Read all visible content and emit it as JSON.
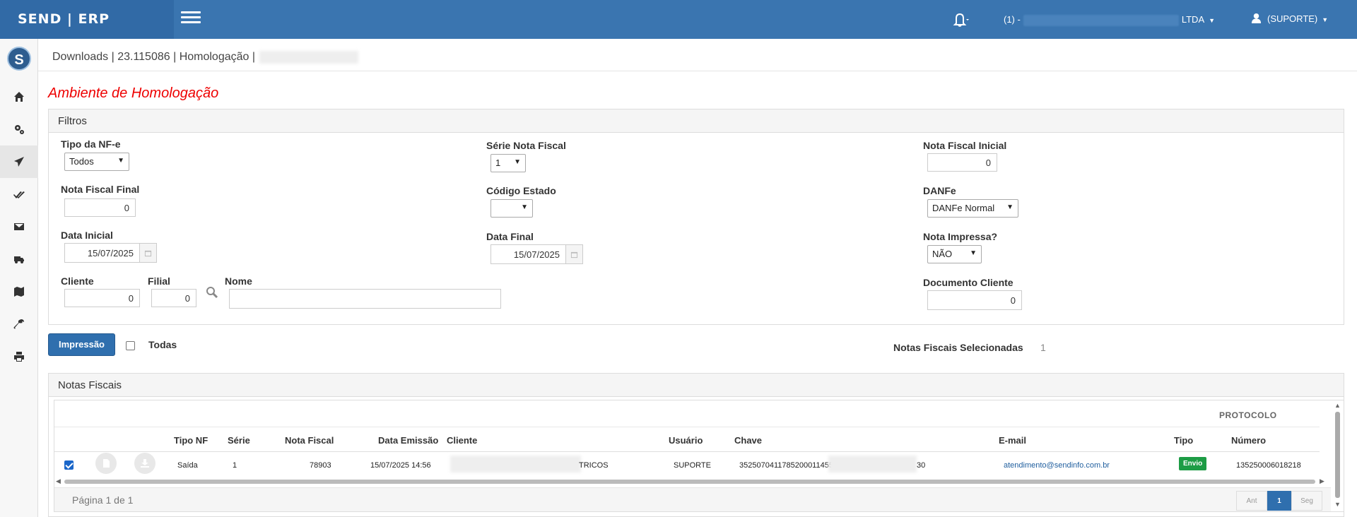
{
  "app": {
    "brand": "SEND | ERP"
  },
  "topbar": {
    "company_prefix": "(1) -",
    "company_suffix": "LTDA",
    "user_label": "(SUPORTE)"
  },
  "breadcrumb": "Downloads | 23.115086 | Homologação |",
  "env_title": "Ambiente de Homologação",
  "filters": {
    "panel_title": "Filtros",
    "tipo_nfe": {
      "label": "Tipo da NF-e",
      "value": "Todos"
    },
    "serie": {
      "label": "Série Nota Fiscal",
      "value": "1"
    },
    "nf_inicial": {
      "label": "Nota Fiscal Inicial",
      "value": "0"
    },
    "nf_final": {
      "label": "Nota Fiscal Final",
      "value": "0"
    },
    "codigo_estado": {
      "label": "Código Estado",
      "value": ""
    },
    "danfe": {
      "label": "DANFe",
      "value": "DANFe Normal"
    },
    "data_inicial": {
      "label": "Data Inicial",
      "value": "15/07/2025"
    },
    "data_final": {
      "label": "Data Final",
      "value": "15/07/2025"
    },
    "nota_impressa": {
      "label": "Nota Impressa?",
      "value": "NÃO"
    },
    "cliente": {
      "label": "Cliente",
      "value": "0"
    },
    "filial": {
      "label": "Filial",
      "value": "0"
    },
    "nome": {
      "label": "Nome",
      "value": ""
    },
    "documento_cliente": {
      "label": "Documento Cliente",
      "value": "0"
    }
  },
  "actions": {
    "print_label": "Impressão",
    "all_label": "Todas",
    "selected_label": "Notas Fiscais Selecionadas",
    "selected_count": "1"
  },
  "notas": {
    "panel_title": "Notas Fiscais",
    "group_header": "PROTOCOLO",
    "columns": {
      "tipo_nf": "Tipo NF",
      "serie": "Série",
      "nota_fiscal": "Nota Fiscal",
      "data_emissao": "Data Emissão",
      "cliente": "Cliente",
      "usuario": "Usuário",
      "chave": "Chave",
      "email": "E-mail",
      "tipo": "Tipo",
      "numero": "Número"
    },
    "rows": [
      {
        "selected": true,
        "tipo_nf": "Saída",
        "serie": "1",
        "nota_fiscal": "78903",
        "data_emissao": "15/07/2025 14:56",
        "cliente": "TRICOS",
        "usuario": "SUPORTE",
        "chave_start": "3525070411785200011455",
        "chave_end": "30",
        "email": "atendimento@sendinfo.com.br",
        "tipo": "Envio",
        "numero": "135250006018218"
      }
    ],
    "pagination": {
      "info": "Página 1 de 1",
      "prev": "Ant",
      "current": "1",
      "next": "Seg"
    }
  },
  "colors": {
    "primary": "#3a75b0",
    "danger": "#ee0000",
    "success": "#1d9c45",
    "link": "#1f5e9e"
  }
}
